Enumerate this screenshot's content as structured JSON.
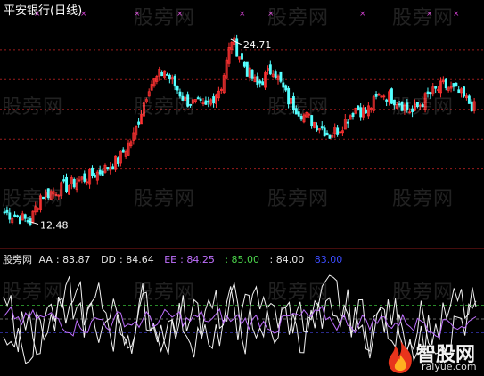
{
  "title": "平安银行(日线)",
  "watermark": "股旁网",
  "logo": {
    "brand": "智股网",
    "url": "raiyue.com"
  },
  "colors": {
    "up": "#ff3232",
    "down": "#54ffff",
    "white": "#ffffff",
    "magenta": "#c070ff",
    "grid": "#9a1c1c",
    "dashed": "#2a8a2a"
  },
  "chart_data": [
    {
      "type": "candlestick",
      "title": "平安银行(日线)",
      "annotations": [
        {
          "text": "24.71",
          "kind": "high"
        },
        {
          "text": "12.48",
          "kind": "low"
        }
      ],
      "ylim": [
        11.2,
        26.5
      ],
      "gridlines": true,
      "high": 24.71,
      "low": 12.48,
      "bars": 140
    },
    {
      "type": "line",
      "indicator_name": "股旁网",
      "labels": [
        {
          "name": "AA",
          "value": "83.87",
          "color": "#e6e6e6"
        },
        {
          "name": "DD",
          "value": "84.64",
          "color": "#e6e6e6"
        },
        {
          "name": "EE",
          "value": "84.25",
          "color": "#c070ff"
        },
        {
          "name": "",
          "value": "85.00",
          "color": "#4cd64c"
        },
        {
          "name": "",
          "value": "84.00",
          "color": "#e6e6e6"
        },
        {
          "name": "",
          "value": "83.00",
          "color": "#3c4cff"
        }
      ],
      "ylim": [
        76,
        92
      ],
      "reference_levels": [
        85.0,
        84.0,
        83.0
      ]
    }
  ]
}
